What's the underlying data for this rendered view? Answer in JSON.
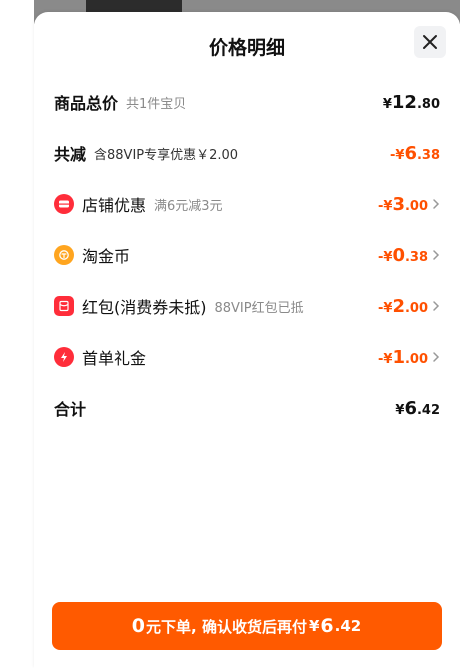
{
  "sheet": {
    "title": "价格明细"
  },
  "rows": {
    "subtotal": {
      "label": "商品总价",
      "sub": "共1件宝贝",
      "symbol": "¥",
      "int": "12",
      "dec": ".80"
    },
    "total_discount": {
      "label": "共减",
      "sub": "含88VIP专享优惠￥2.00",
      "symbol": "-¥",
      "int": "6",
      "dec": ".38"
    },
    "store_discount": {
      "label": "店铺优惠",
      "sub": "满6元减3元",
      "symbol": "-¥",
      "int": "3",
      "dec": ".00",
      "icon": "store-coupon-icon",
      "icon_color": "#ff2d3a"
    },
    "taojin_coin": {
      "label": "淘金币",
      "symbol": "-¥",
      "int": "0",
      "dec": ".38",
      "icon": "coin-icon",
      "icon_color": "#ffa51f"
    },
    "red_packet": {
      "label": "红包(消费券未抵)",
      "sub": "88VIP红包已抵",
      "symbol": "-¥",
      "int": "2",
      "dec": ".00",
      "icon": "red-packet-icon",
      "icon_color": "#ff2d3a"
    },
    "first_order": {
      "label": "首单礼金",
      "symbol": "-¥",
      "int": "1",
      "dec": ".00",
      "icon": "lightning-icon",
      "icon_color": "#ff2d3a"
    },
    "grand_total": {
      "label": "合计",
      "symbol": "¥",
      "int": "6",
      "dec": ".42"
    }
  },
  "cta": {
    "zero": "0",
    "text": "元下单, 确认收货后再付",
    "symbol": "¥",
    "int": "6",
    "dec": ".42"
  },
  "colors": {
    "accent": "#ff5000",
    "cta_bg": "#ff5a00",
    "red_icon": "#ff2d3a",
    "coin_icon": "#ffa51f"
  }
}
